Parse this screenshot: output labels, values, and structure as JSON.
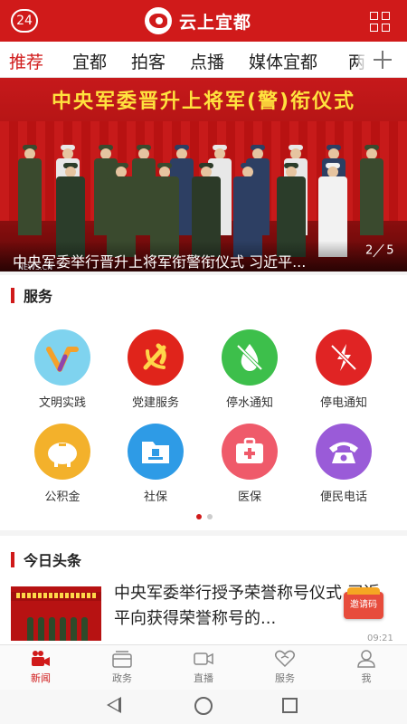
{
  "topbar": {
    "left_badge": "24",
    "app_title": "云上宜都",
    "colors": {
      "brand": "#d01a1a"
    }
  },
  "channels": [
    {
      "label": "推荐",
      "active": true
    },
    {
      "label": "宜都",
      "active": false
    },
    {
      "label": "拍客",
      "active": false
    },
    {
      "label": "点播",
      "active": false
    },
    {
      "label": "媒体宜都",
      "active": false
    },
    {
      "label": "两",
      "active": false
    }
  ],
  "banner": {
    "stage_title": "中央军委晋升上将军(警)衔仪式",
    "caption": "中央军委举行晋升上将军衔警衔仪式 习近平...",
    "page_current": "2",
    "page_total": "5",
    "watermark": "NEWS.CN"
  },
  "services": {
    "title": "服务",
    "items": [
      {
        "name": "文明实践",
        "icon": "civilization-practice-icon",
        "color": "#7fd3ef"
      },
      {
        "name": "党建服务",
        "icon": "party-building-icon",
        "color": "#e0241b"
      },
      {
        "name": "停水通知",
        "icon": "water-outage-icon",
        "color": "#3dbf4b"
      },
      {
        "name": "停电通知",
        "icon": "power-outage-icon",
        "color": "#e02424"
      },
      {
        "name": "公积金",
        "icon": "piggy-bank-icon",
        "color": "#f3b12b"
      },
      {
        "name": "社保",
        "icon": "social-security-icon",
        "color": "#2e9be6"
      },
      {
        "name": "医保",
        "icon": "medical-kit-icon",
        "color": "#ef5a6a"
      },
      {
        "name": "便民电话",
        "icon": "telephone-icon",
        "color": "#9a5bd8"
      }
    ],
    "pager": {
      "current": 1,
      "total": 2
    }
  },
  "headlines": {
    "title": "今日头条",
    "article": {
      "title": "中央军委举行授予荣誉称号仪式 习近平向获得荣誉称号的...",
      "time": "09:21"
    },
    "invite_badge": "邀请码"
  },
  "tabbar": [
    {
      "label": "新闻",
      "icon": "news-video-icon",
      "active": true
    },
    {
      "label": "政务",
      "icon": "government-affairs-icon",
      "active": false
    },
    {
      "label": "直播",
      "icon": "live-camera-icon",
      "active": false
    },
    {
      "label": "服务",
      "icon": "service-heart-icon",
      "active": false
    },
    {
      "label": "我",
      "icon": "profile-icon",
      "active": false
    }
  ],
  "system_nav": {
    "buttons": [
      "back",
      "home",
      "recents"
    ]
  }
}
